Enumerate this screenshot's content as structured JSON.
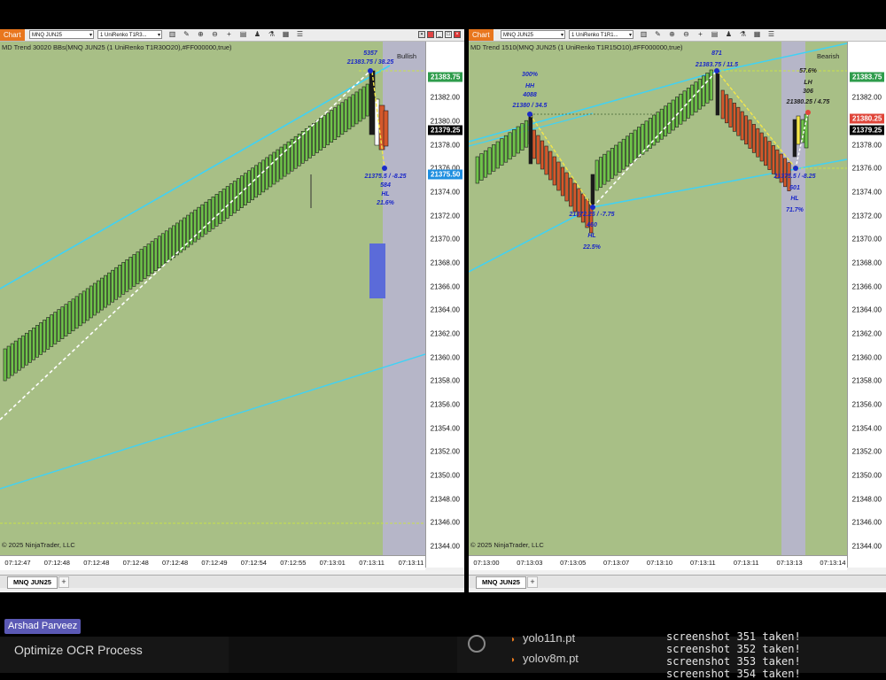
{
  "left_panel": {
    "chart_button": "Chart",
    "instrument_select": "MNQ JUN25",
    "bar_type_select": "1 UniRenko T1R3...",
    "indicator_label": "MD Trend 30020 BBs(MNQ JUN25 (1 UniRenko T1R30O20),#FF000000,true)",
    "trend_label": "Bullish",
    "copyright": "© 2025 NinjaTrader, LLC",
    "tab_label": "MNQ JUN25",
    "price_labels": [
      "21382.00",
      "21380.00",
      "21378.00",
      "21376.00",
      "21374.00",
      "21372.00",
      "21370.00",
      "21368.00",
      "21366.00",
      "21364.00",
      "21362.00",
      "21360.00",
      "21358.00",
      "21356.00",
      "21354.00",
      "21352.00",
      "21350.00",
      "21348.00",
      "21346.00",
      "21344.00"
    ],
    "price_tags": [
      {
        "text": "21383.75",
        "bg": "#2e9c4b",
        "fg": "#ffffff"
      },
      {
        "text": "21379.25",
        "bg": "#000000",
        "fg": "#ffffff"
      },
      {
        "text": "21375.50",
        "bg": "#1f8fe0",
        "fg": "#ffffff"
      }
    ],
    "time_labels": [
      "07:12:47",
      "07:12:48",
      "07:12:48",
      "07:12:48",
      "07:12:48",
      "07:12:49",
      "07:12:54",
      "07:12:55",
      "07:13:01",
      "07:13:11",
      "07:13:11"
    ],
    "annotations": {
      "top": [
        "5357",
        "21383.75 / 38.25"
      ],
      "bottom": [
        "21375.5 / -8.25",
        "584",
        "HL",
        "21.6%"
      ]
    }
  },
  "right_panel": {
    "chart_button": "Chart",
    "instrument_select": "MNQ JUN25",
    "bar_type_select": "1 UniRenko T1R1...",
    "indicator_label": "MD Trend 1510(MNQ JUN25 (1 UniRenko T1R15O10),#FF000000,true)",
    "trend_label": "Bearish",
    "copyright": "© 2025 NinjaTrader, LLC",
    "tab_label": "MNQ JUN25",
    "price_labels": [
      "21382.00",
      "21380.00",
      "21378.00",
      "21376.00",
      "21374.00",
      "21372.00",
      "21370.00",
      "21368.00",
      "21366.00",
      "21364.00",
      "21362.00",
      "21360.00",
      "21358.00",
      "21356.00",
      "21354.00",
      "21352.00",
      "21350.00",
      "21348.00",
      "21346.00",
      "21344.00"
    ],
    "price_tags": [
      {
        "text": "21383.75",
        "bg": "#2e9c4b",
        "fg": "#ffffff"
      },
      {
        "text": "21380.25",
        "bg": "#e0463a",
        "fg": "#ffffff"
      },
      {
        "text": "21379.25",
        "bg": "#000000",
        "fg": "#ffffff"
      }
    ],
    "time_labels": [
      "07:13:00",
      "07:13:03",
      "07:13:05",
      "07:13:07",
      "07:13:10",
      "07:13:11",
      "07:13:11",
      "07:13:13",
      "07:13:14"
    ],
    "annotations": {
      "hh": [
        "300%",
        "HH",
        "4088",
        "21380 / 34.5"
      ],
      "top": [
        "871",
        "21383.75 / 11.5"
      ],
      "low": [
        "21372.25 / -7.75",
        "460",
        "HL",
        "22.5%"
      ],
      "lh": [
        "57.6%",
        "LH",
        "306",
        "21380.25 / 4.75"
      ],
      "bottom": [
        "21375.5 / -8.25",
        "601",
        "HL",
        "71.7%"
      ]
    }
  },
  "overlay": {
    "user_chip": "Arshad Parveez"
  },
  "taskbar": {
    "title": "Optimize OCR Process",
    "files": [
      "yolo11n.pt",
      "yolov8m.pt"
    ],
    "terminal_lines": [
      "screenshot 351 taken!",
      "screenshot 352 taken!",
      "screenshot 353 taken!",
      "screenshot 354 taken!"
    ]
  },
  "colors": {
    "plot_bg": "#a8bf86",
    "bull_candle": "#6fc34a",
    "bear_candle": "#d4582b",
    "band_line": "#3fd2f5",
    "annotation_text": "#1a27c8",
    "chart_button": "#e8761d"
  },
  "icons": [
    "bar-chart-icon",
    "pencil-icon",
    "zoom-in-icon",
    "zoom-out-icon",
    "crosshair-icon",
    "data-box-icon",
    "strategy-icon",
    "indicator-icon",
    "properties-icon",
    "list-icon"
  ]
}
